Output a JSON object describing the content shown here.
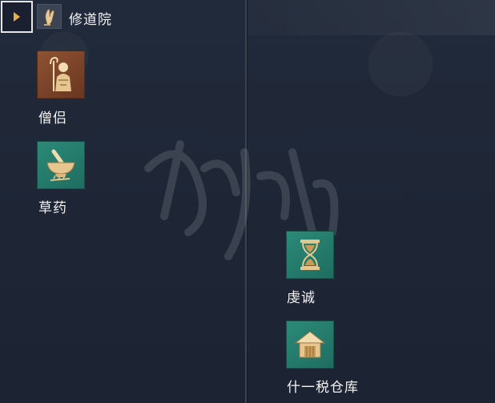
{
  "header": {
    "title": "修道院",
    "expand_icon": "chevron-right-icon",
    "building_icon": "praying-hands-icon"
  },
  "left_column": {
    "items": [
      {
        "label": "僧侣",
        "icon": "monk-icon",
        "tile_color": "#8e5233"
      },
      {
        "label": "草药",
        "icon": "mortar-pestle-icon",
        "tile_color": "#2b8a78"
      }
    ]
  },
  "right_column": {
    "items": [
      {
        "label": "虔诚",
        "icon": "hourglass-icon",
        "tile_color": "#2b8a78"
      },
      {
        "label": "什一税仓库",
        "icon": "storehouse-icon",
        "tile_color": "#2b8a78"
      }
    ]
  },
  "colors": {
    "background": "#1e2535",
    "accent_gold": "#e9b04a",
    "text": "#f2f2f2"
  }
}
